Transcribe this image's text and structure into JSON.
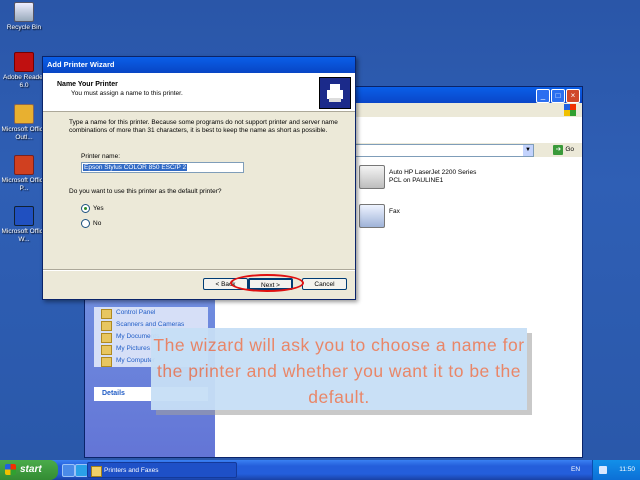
{
  "desktop": {
    "icons": [
      {
        "label": "Recycle Bin"
      },
      {
        "label": "Adobe Reader 6.0"
      },
      {
        "label": "Microsoft Office Outl..."
      },
      {
        "label": "Microsoft Office P..."
      },
      {
        "label": "Microsoft Office W..."
      }
    ]
  },
  "explorer": {
    "go_label": "Go",
    "printers": [
      {
        "name": "Auto HP LaserJet 2200 Series",
        "sub": "PCL on PAULINE1"
      },
      {
        "name": "Fax",
        "sub": ""
      }
    ],
    "other_places": [
      "Control Panel",
      "Scanners and Cameras",
      "My Documents",
      "My Pictures",
      "My Computer"
    ],
    "details_label": "Details"
  },
  "wizard": {
    "title": "Add Printer Wizard",
    "heading": "Name Your Printer",
    "subheading": "You must assign a name to this printer.",
    "instructions": "Type a name for this printer. Because some programs do not support printer and server name combinations of more than 31 characters, it is best to keep the name as short as possible.",
    "printer_name_label": "Printer name:",
    "printer_name_value": "Epson Stylus COLOR 850 ESC/P 2",
    "default_question": "Do you want to use this printer as the default printer?",
    "option_yes": "Yes",
    "option_no": "No",
    "selected_option": "Yes",
    "back_label": "< Back",
    "next_label": "Next >",
    "cancel_label": "Cancel"
  },
  "caption": {
    "text": "The wizard will ask you to choose a name for the printer and whether you want it to be the default.",
    "color": "#e88060"
  },
  "taskbar": {
    "start_label": "start",
    "window_item": "Printers and Faxes",
    "language": "EN",
    "clock": "11:50"
  }
}
